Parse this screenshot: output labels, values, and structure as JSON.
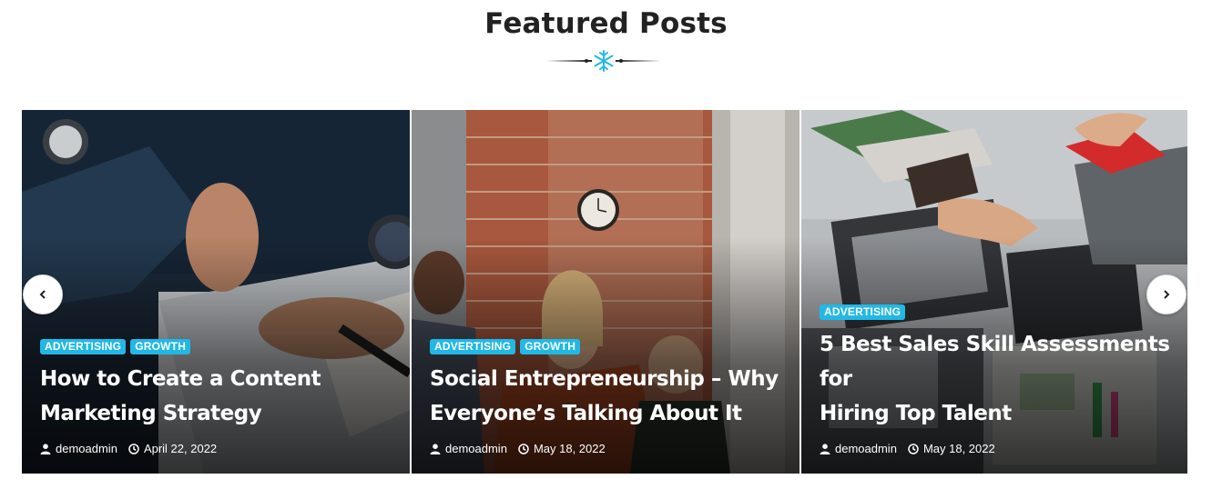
{
  "section": {
    "title": "Featured Posts"
  },
  "colors": {
    "accent": "#21b8e6",
    "title": "#222222"
  },
  "posts": [
    {
      "tags": [
        "ADVERTISING",
        "GROWTH"
      ],
      "title_line1": "How to Create a Content",
      "title_line2": "Marketing Strategy",
      "author": "demoadmin",
      "date": "April 22, 2022"
    },
    {
      "tags": [
        "ADVERTISING",
        "GROWTH"
      ],
      "title_line1": "Social Entrepreneurship – Why",
      "title_line2": "Everyone’s Talking About It",
      "author": "demoadmin",
      "date": "May 18, 2022"
    },
    {
      "tags": [
        "ADVERTISING"
      ],
      "title_line1": "5 Best Sales Skill Assessments for",
      "title_line2": "Hiring Top Talent",
      "author": "demoadmin",
      "date": "May 18, 2022"
    }
  ],
  "icons": {
    "prev": "chevron-left-icon",
    "next": "chevron-right-icon",
    "author": "user-icon",
    "date": "clock-icon",
    "divider": "snowflake-icon"
  }
}
